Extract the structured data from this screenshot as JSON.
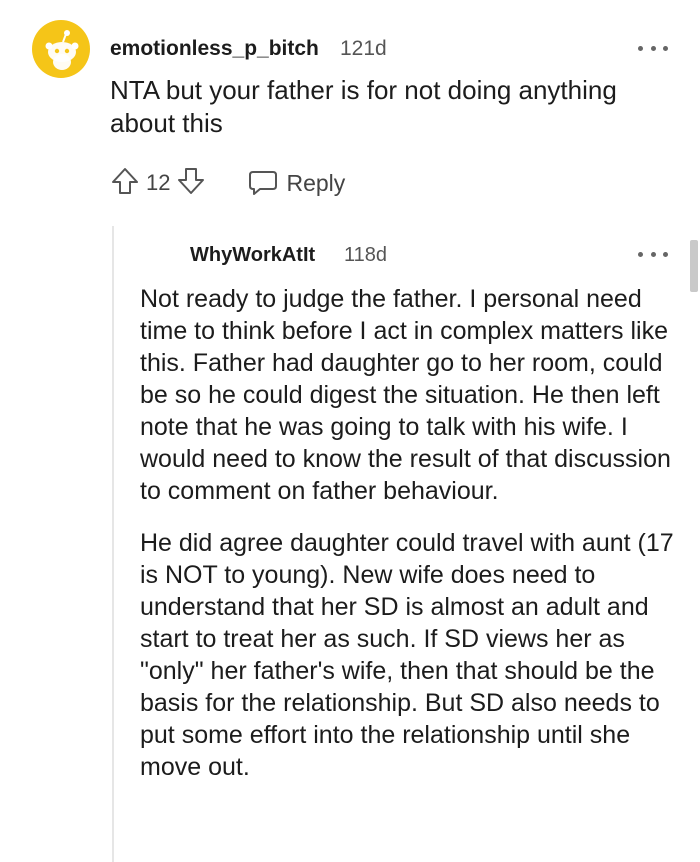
{
  "comment1": {
    "username": "emotionless_p_bitch",
    "age": "121d",
    "text": "NTA but your father is for not doing anything about this",
    "vote_count": "12",
    "reply_label": "Reply"
  },
  "comment2": {
    "username": "WhyWorkAtIt",
    "age": "118d",
    "paragraphs": [
      "Not ready to judge the father. I personal need time to think before I act in complex matters like this. Father had daughter go to her room, could be so he could digest the situation. He then left note that he was going to talk with his wife. I would need to know the result of that discussion to comment on father behaviour.",
      "He did agree daughter could travel with aunt (17 is NOT to young). New wife does need to understand that her SD is almost an adult and start to treat her as such. If SD views her as \"only\" her father's wife, then that should be the basis for the relationship. But SD also needs to put some effort into the relationship until she move out."
    ]
  },
  "colors": {
    "avatar_bg": "#f5c518",
    "text": "#1c1c1c",
    "muted": "#555555"
  },
  "icons": {
    "avatar": "snoo-avatar-icon",
    "upvote": "upvote-arrow-icon",
    "downvote": "downvote-arrow-icon",
    "reply": "speech-bubble-icon",
    "more": "more-options-icon"
  }
}
